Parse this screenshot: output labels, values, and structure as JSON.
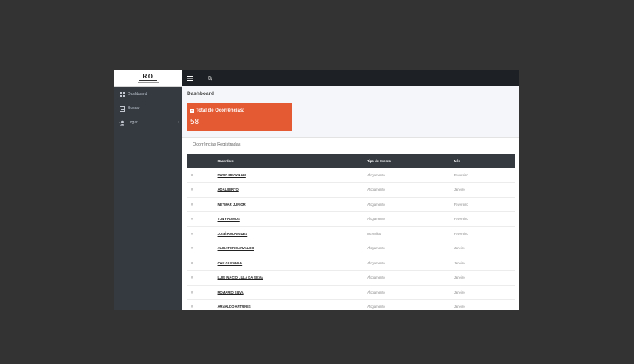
{
  "brand": {
    "logo_text": "RO"
  },
  "sidebar": {
    "items": [
      {
        "label": "Dashboard",
        "icon": "dashboard-icon"
      },
      {
        "label": "Buscar",
        "icon": "search-icon"
      },
      {
        "label": "Logar",
        "icon": "users-icon",
        "chevron": "‹"
      }
    ]
  },
  "topbar": {
    "menu_icon": "hamburger-icon",
    "search_icon": "search-icon"
  },
  "page": {
    "title": "Dashboard"
  },
  "info_box": {
    "label": "Total de Ocorrências:",
    "value": "58",
    "icon": "list-icon",
    "color": "#e45a33"
  },
  "card": {
    "title": "Ocorrências Registradas"
  },
  "table": {
    "headers": [
      "",
      "Sacerdote",
      "Tipo de Evento",
      "Mês"
    ],
    "rows": [
      {
        "id": "#",
        "name": "DAVID BECKHAM",
        "tipo": "Afogamento",
        "mes": "Fevereiro"
      },
      {
        "id": "#",
        "name": "ADALBERTO",
        "tipo": "Afogamento",
        "mes": "Janeiro"
      },
      {
        "id": "#",
        "name": "NEYMAR JUNIOR",
        "tipo": "Afogamento",
        "mes": "Fevereiro"
      },
      {
        "id": "#",
        "name": "TONY RAMOS",
        "tipo": "Afogamento",
        "mes": "Fevereiro"
      },
      {
        "id": "#",
        "name": "JOSÉ RODRIGUES",
        "tipo": "Incendios",
        "mes": "Fevereiro"
      },
      {
        "id": "#",
        "name": "ALIGATOR CARVALHO",
        "tipo": "Afogamento",
        "mes": "Janeiro"
      },
      {
        "id": "#",
        "name": "CHE GUEVARA",
        "tipo": "Afogamento",
        "mes": "Janeiro"
      },
      {
        "id": "#",
        "name": "LUIS INACIO LULA DA SILVA",
        "tipo": "Afogamento",
        "mes": "Janeiro"
      },
      {
        "id": "#",
        "name": "ROMARIO SILVA",
        "tipo": "Afogamento",
        "mes": "Janeiro"
      },
      {
        "id": "#",
        "name": "ARNALDO ANTUNES",
        "tipo": "Afogamento",
        "mes": "Janeiro"
      }
    ]
  }
}
